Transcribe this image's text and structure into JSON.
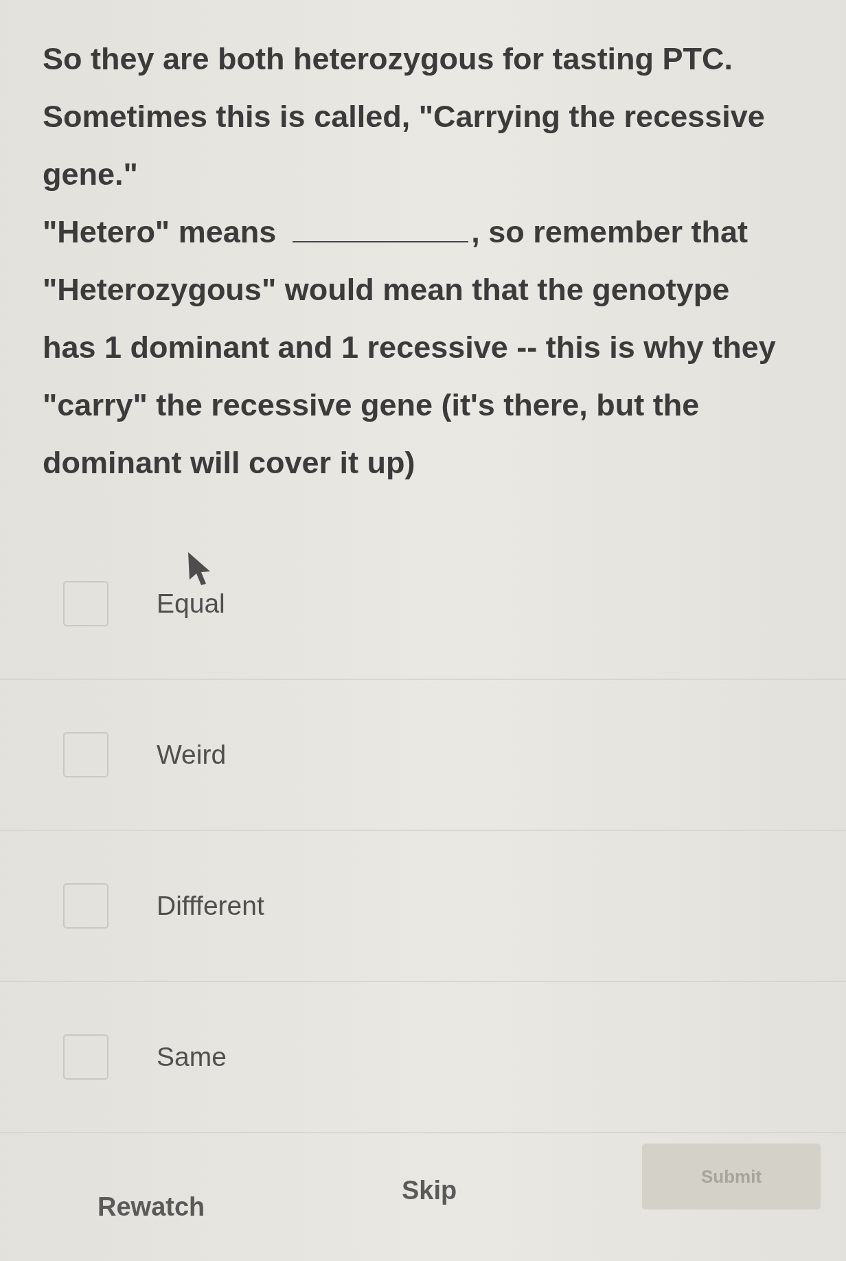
{
  "lesson": {
    "paragraphs": [
      "So they are both heterozygous for tasting PTC.",
      "Sometimes this is called, \"Carrying the recessive gene.\""
    ],
    "blank_sentence": {
      "before": "\"Hetero\" means",
      "after": ", so remember that"
    },
    "explanation": "\"Heterozygous\" would mean that the genotype has 1 dominant and 1 recessive -- this is why they \"carry\" the recessive gene (it's there, but the dominant will cover it up)"
  },
  "choices": [
    {
      "label": "Equal",
      "checked": false
    },
    {
      "label": "Weird",
      "checked": false
    },
    {
      "label": "Diffferent",
      "checked": false
    },
    {
      "label": "Same",
      "checked": false
    }
  ],
  "buttons": [
    {
      "label": "Rewatch",
      "kind": "text",
      "disabled": false
    },
    {
      "label": "Skip",
      "kind": "text",
      "disabled": false
    },
    {
      "label": "Submit",
      "kind": "filled",
      "disabled": true
    }
  ]
}
